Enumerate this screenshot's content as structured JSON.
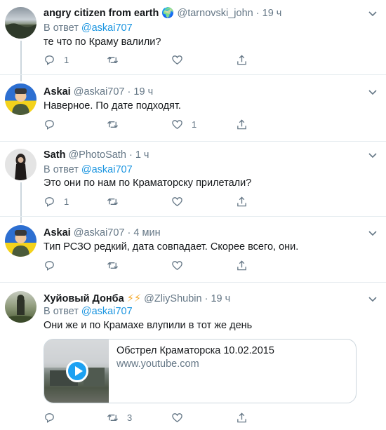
{
  "tweets": [
    {
      "name": "angry citizen from earth",
      "emoji": "🌍",
      "handle": "@tarnovski_john",
      "dot": "·",
      "time": "19 ч",
      "reply_prefix": "В ответ",
      "reply_to": "@askai707",
      "text": "те что по Краму валили?",
      "replies": "1",
      "retweets": "",
      "likes": ""
    },
    {
      "name": "Askai",
      "handle": "@askai707",
      "dot": "·",
      "time": "19 ч",
      "text": "Наверное. По дате подходят.",
      "replies": "",
      "retweets": "",
      "likes": "1"
    },
    {
      "name": "Sath",
      "handle": "@PhotoSath",
      "dot": "·",
      "time": "1 ч",
      "reply_prefix": "В ответ",
      "reply_to": "@askai707",
      "text": "Это они по нам по Краматорску прилетали?",
      "replies": "1",
      "retweets": "",
      "likes": ""
    },
    {
      "name": "Askai",
      "handle": "@askai707",
      "dot": "·",
      "time": "4 мин",
      "text": "Тип РСЗО редкий, дата совпадает. Скорее всего, они.",
      "replies": "",
      "retweets": "",
      "likes": ""
    },
    {
      "name": "Хуйовый Донба",
      "emoji": "⚡⚡",
      "handle": "@ZliyShubin",
      "dot": "·",
      "time": "19 ч",
      "reply_prefix": "В ответ",
      "reply_to": "@askai707",
      "text": "Они же и по Крамахе влупили в тот же день",
      "replies": "",
      "retweets": "3",
      "likes": "",
      "card": {
        "title": "Обстрел Краматорска 10.02.2015",
        "url": "www.youtube.com"
      }
    }
  ],
  "colors": {
    "accent": "#1b95e0",
    "muted": "#657786",
    "thread_line": "#ccd6dd"
  },
  "icons": [
    "reply-icon",
    "retweet-icon",
    "like-icon",
    "share-icon",
    "chevron-down-icon",
    "play-icon"
  ]
}
